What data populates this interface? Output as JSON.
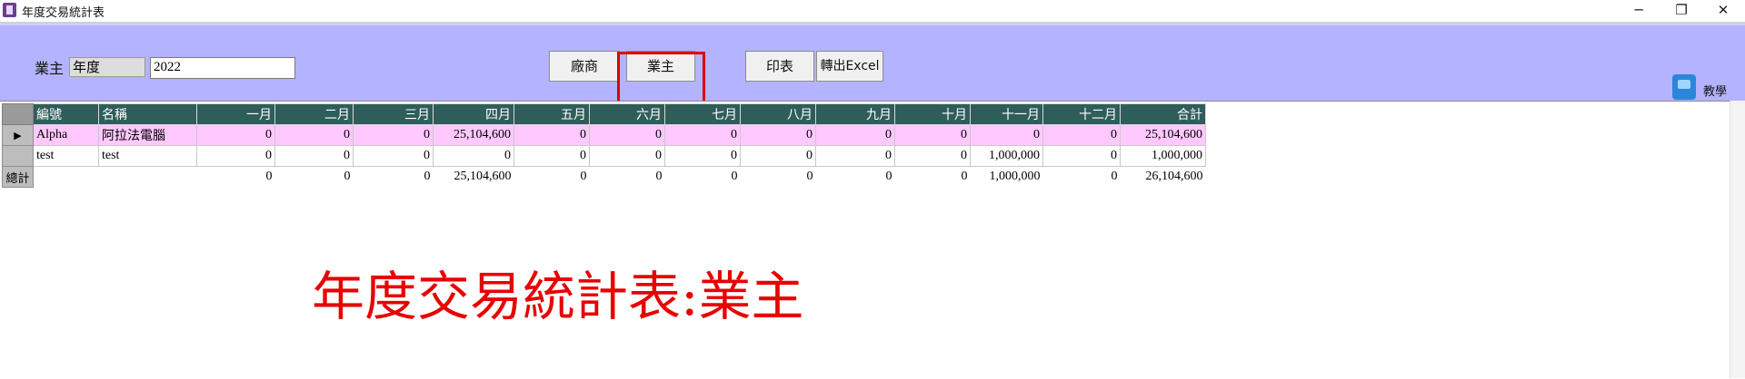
{
  "window": {
    "title": "年度交易統計表",
    "controls": [
      "─",
      "❐",
      "✕"
    ]
  },
  "toolbar": {
    "owner_label": "業主",
    "year_label": "年度",
    "year_value": "2022",
    "vendor_button": "廠商",
    "owner_button": "業主",
    "print_button": "印表",
    "excel_button": "轉出Excel",
    "teach_label": "教學"
  },
  "grid": {
    "columns": [
      "編號",
      "名稱",
      "一月",
      "二月",
      "三月",
      "四月",
      "五月",
      "六月",
      "七月",
      "八月",
      "九月",
      "十月",
      "十一月",
      "十二月",
      "合計"
    ],
    "rows": [
      {
        "selected": true,
        "indicator": "▶",
        "cells": [
          "Alpha",
          "阿拉法電腦",
          "0",
          "0",
          "0",
          "25,104,600",
          "0",
          "0",
          "0",
          "0",
          "0",
          "0",
          "0",
          "0",
          "25,104,600"
        ]
      },
      {
        "selected": false,
        "indicator": "",
        "cells": [
          "test",
          "test",
          "0",
          "0",
          "0",
          "0",
          "0",
          "0",
          "0",
          "0",
          "0",
          "0",
          "1,000,000",
          "0",
          "1,000,000"
        ]
      }
    ],
    "total": {
      "label": "總計",
      "cells": [
        "",
        "",
        "0",
        "0",
        "0",
        "25,104,600",
        "0",
        "0",
        "0",
        "0",
        "0",
        "0",
        "1,000,000",
        "0",
        "26,104,600"
      ]
    }
  },
  "caption": "年度交易統計表:業主",
  "colors": {
    "panel_bg": "#b3b3ff",
    "header_bg": "#2f5d5a",
    "selected_row_bg": "#ffc8ff",
    "highlight_border": "#e00000",
    "caption_color": "#e80000"
  }
}
